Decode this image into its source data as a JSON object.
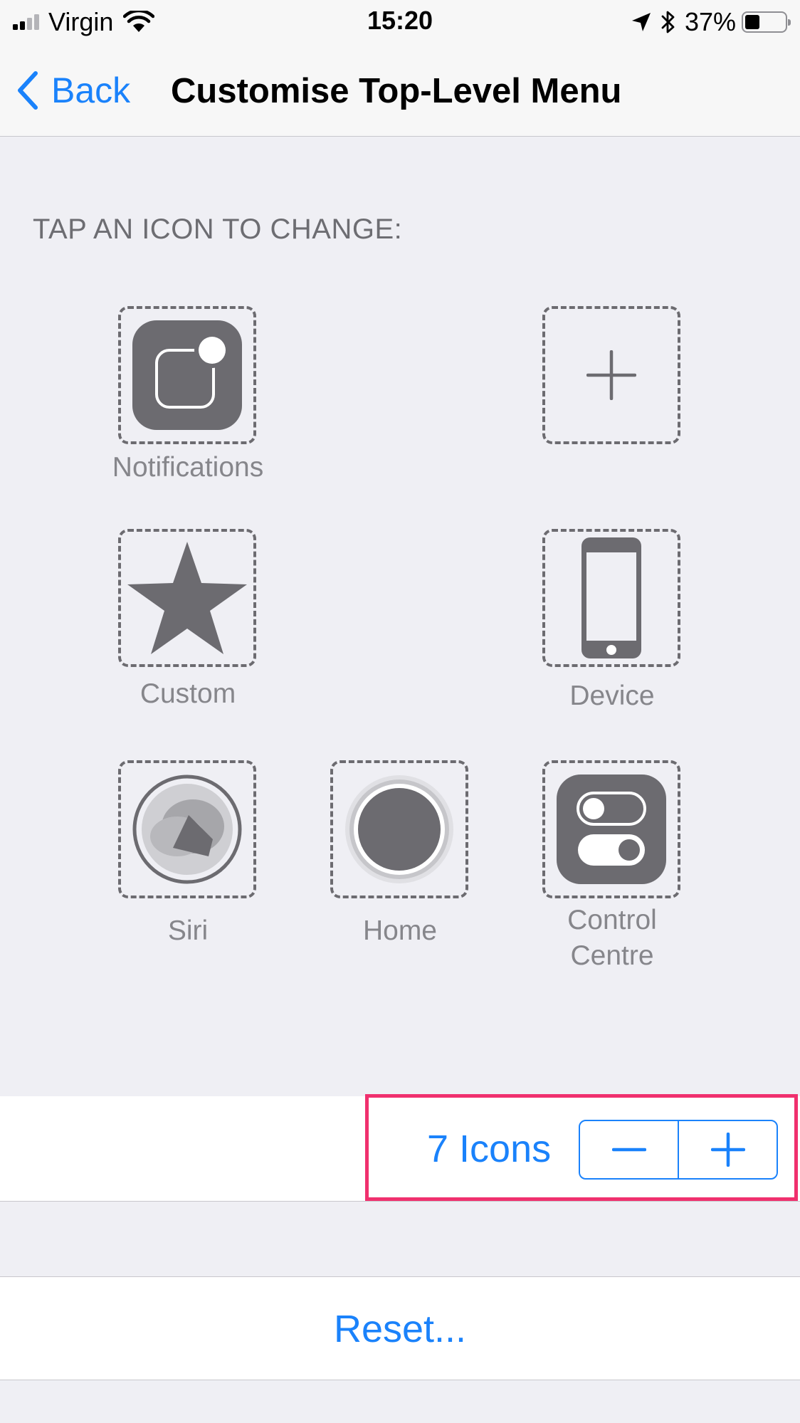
{
  "status_bar": {
    "carrier": "Virgin",
    "time": "15:20",
    "battery_percent": "37%",
    "battery_level": 0.37,
    "signal_bars_filled": 2,
    "signal_bars_total": 4,
    "icons": [
      "signal-icon",
      "wifi-icon",
      "location-arrow-icon",
      "bluetooth-icon",
      "battery-icon"
    ]
  },
  "nav": {
    "back_label": "Back",
    "title": "Customise Top-Level Menu"
  },
  "section_header": "TAP AN ICON TO CHANGE:",
  "icons": {
    "notifications": {
      "label": "Notifications",
      "icon": "notifications-icon"
    },
    "add": {
      "label": "",
      "icon": "plus-icon"
    },
    "custom": {
      "label": "Custom",
      "icon": "star-icon"
    },
    "device": {
      "label": "Device",
      "icon": "iphone-icon"
    },
    "siri": {
      "label": "Siri",
      "icon": "siri-icon"
    },
    "home": {
      "label": "Home",
      "icon": "home-button-icon"
    },
    "control_centre": {
      "label_line1": "Control",
      "label_line2": "Centre",
      "icon": "control-centre-icon"
    }
  },
  "count": {
    "label": "7 Icons",
    "value": 7,
    "decrement_icon": "minus-icon",
    "increment_icon": "plus-icon"
  },
  "reset": {
    "label": "Reset..."
  },
  "colors": {
    "accent": "#1a82fb",
    "highlight": "#f0306e",
    "icon_gray": "#6c6b70",
    "background": "#efeff4"
  }
}
